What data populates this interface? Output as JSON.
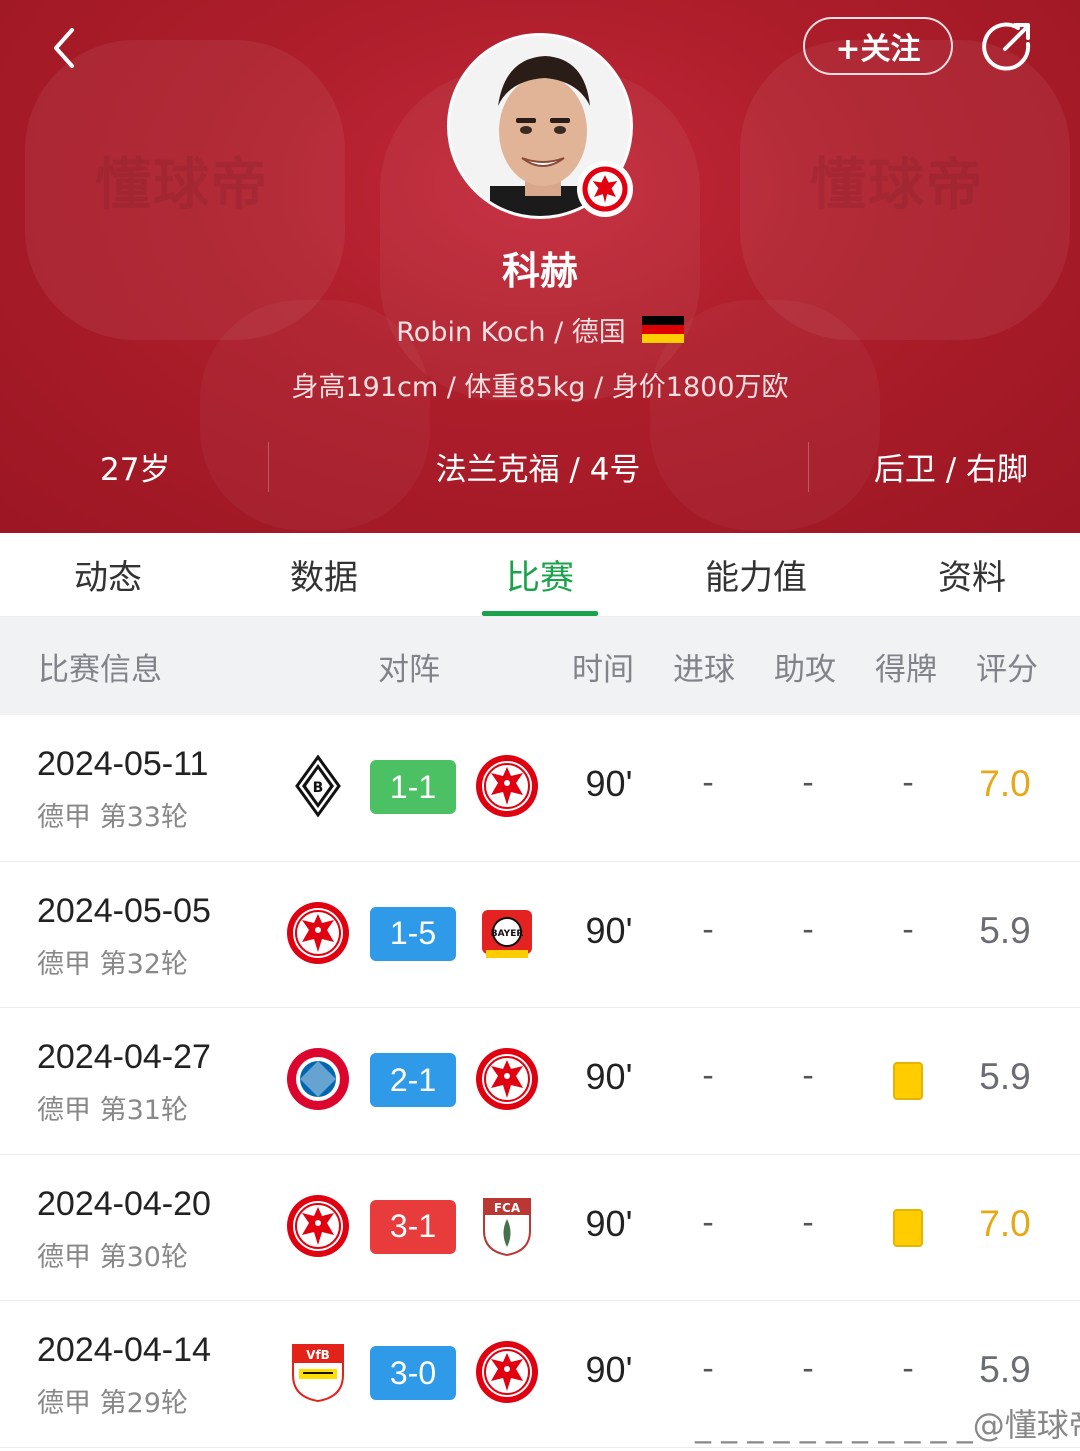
{
  "header": {
    "back_icon": "chevron-left-icon",
    "follow_label": "+关注",
    "share_icon": "share-icon",
    "watermark": "懂球帝",
    "player": {
      "name": "科赫",
      "en_name": "Robin Koch",
      "nationality": "德国",
      "nationality_sub": "Robin Koch / 德国",
      "physical": "身高191cm / 体重85kg / 身价1800万欧",
      "age": "27岁",
      "club_number": "法兰克福 / 4号",
      "position_foot": "后卫 / 右脚"
    }
  },
  "tabs": [
    {
      "label": "动态",
      "active": false
    },
    {
      "label": "数据",
      "active": false
    },
    {
      "label": "比赛",
      "active": true
    },
    {
      "label": "能力值",
      "active": false
    },
    {
      "label": "资料",
      "active": false
    }
  ],
  "table": {
    "headers": {
      "info": "比赛信息",
      "match": "对阵",
      "time": "时间",
      "goals": "进球",
      "assists": "助攻",
      "cards": "得牌",
      "rating": "评分"
    },
    "rows": [
      {
        "date": "2024-05-11",
        "league": "德甲 第33轮",
        "home": "gladbach",
        "away": "frankfurt",
        "score": "1-1",
        "result": "draw",
        "minute": "90'",
        "goals": "-",
        "assists": "-",
        "cards": "-",
        "rating": "7.0",
        "highlight": true
      },
      {
        "date": "2024-05-05",
        "league": "德甲 第32轮",
        "home": "frankfurt",
        "away": "leverkusen",
        "score": "1-5",
        "result": "loss",
        "minute": "90'",
        "goals": "-",
        "assists": "-",
        "cards": "-",
        "rating": "5.9",
        "highlight": false
      },
      {
        "date": "2024-04-27",
        "league": "德甲 第31轮",
        "home": "bayern",
        "away": "frankfurt",
        "score": "2-1",
        "result": "loss",
        "minute": "90'",
        "goals": "-",
        "assists": "-",
        "cards": "yellow",
        "rating": "5.9",
        "highlight": false
      },
      {
        "date": "2024-04-20",
        "league": "德甲 第30轮",
        "home": "frankfurt",
        "away": "augsburg",
        "score": "3-1",
        "result": "win",
        "minute": "90'",
        "goals": "-",
        "assists": "-",
        "cards": "yellow",
        "rating": "7.0",
        "highlight": true
      },
      {
        "date": "2024-04-14",
        "league": "德甲 第29轮",
        "home": "stuttgart",
        "away": "frankfurt",
        "score": "3-0",
        "result": "loss",
        "minute": "90'",
        "goals": "-",
        "assists": "-",
        "cards": "-",
        "rating": "5.9",
        "highlight": false
      }
    ]
  },
  "colors": {
    "header_red": "#ae1e2b",
    "tab_active": "#19a34a",
    "win": "#e83b3b",
    "draw": "#4cc163",
    "loss": "#2f9be8",
    "rating_high": "#e8a815",
    "rating_normal": "#6a6d73",
    "yellow_card": "#ffcc00"
  },
  "footer_watermark": "_ _ _ _ _ _ _ _ _ _ _@懂球帝"
}
